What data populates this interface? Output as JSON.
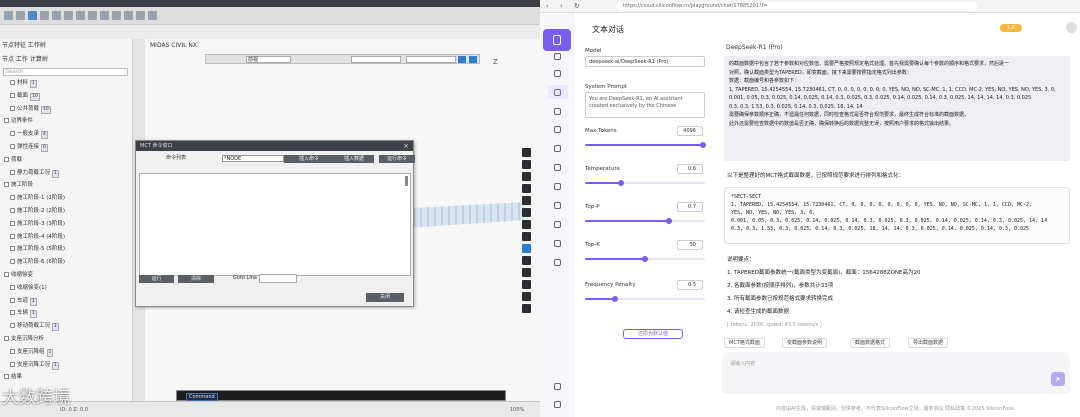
{
  "cad": {
    "panel_title": "节点特征  工作树",
    "panel_tabs": "节点  工作  计算树",
    "search_placeholder": "Search",
    "viewport_tab": "MIDAS CIVIL NX",
    "view_select": "前视",
    "axis_label": "Z",
    "tree": [
      {
        "label": "材料",
        "badge": "1"
      },
      {
        "label": "截面",
        "badge": "10"
      },
      {
        "label": "公共荷载",
        "badge": "10"
      },
      {
        "label": "边界条件",
        "badge": ""
      },
      {
        "label": "一般支承",
        "badge": "4"
      },
      {
        "label": "弹性连接",
        "badge": "6"
      },
      {
        "label": "荷载",
        "badge": ""
      },
      {
        "label": "静力荷载工况",
        "badge": "1"
      },
      {
        "label": "施工阶段",
        "badge": ""
      },
      {
        "label": "施工阶段-1 (1阶段)",
        "badge": ""
      },
      {
        "label": "施工阶段-2 (2阶段)",
        "badge": ""
      },
      {
        "label": "施工阶段-3 (3阶段)",
        "badge": ""
      },
      {
        "label": "施工阶段-4 (4阶段)",
        "badge": ""
      },
      {
        "label": "施工阶段-5 (5阶段)",
        "badge": ""
      },
      {
        "label": "施工阶段-6 (6阶段)",
        "badge": ""
      },
      {
        "label": "收缩徐变",
        "badge": ""
      },
      {
        "label": "收缩徐变(1)",
        "badge": ""
      },
      {
        "label": "车道",
        "badge": "1"
      },
      {
        "label": "车辆",
        "badge": "1"
      },
      {
        "label": "移动荷载工况",
        "badge": "1"
      },
      {
        "label": "支座沉降分析",
        "badge": ""
      },
      {
        "label": "支座沉降组",
        "badge": "1"
      },
      {
        "label": "支座沉降工况",
        "badge": "1"
      },
      {
        "label": "结果",
        "badge": ""
      }
    ],
    "dialog": {
      "title": "MCT 命令窗口",
      "label_cmd": "命令列表",
      "select_value": "*NODE",
      "btn_insert": "插入命令",
      "btn_insert_data": "插入数据",
      "btn_run": "运行命令",
      "btn_load": "运行",
      "btn_clear": "清除",
      "goto_label": "Goto Line",
      "close_btn": "关闭"
    },
    "command_label": "Command",
    "status_left": "ID: 0    Z: 0.0",
    "status_right": "100%",
    "watermark": "大数跨境"
  },
  "web": {
    "url": "https://cloud.siliconflow.cn/playground/chat/17885201?f=",
    "page_title": "文本对话",
    "coin": "1.0",
    "model_label": "Model",
    "model_value": "deepseek-ai/DeepSeek-R1 (Pro)",
    "system_prompt_label": "System Prompt",
    "system_prompt_value": "You are DeepSeek-R1, an AI assistant created exclusively by the Chinese",
    "params": [
      {
        "label": "Max Tokens",
        "value": "4096",
        "level": 0.98
      },
      {
        "label": "Temperature",
        "value": "0.6",
        "level": 0.3
      },
      {
        "label": "Top-P",
        "value": "0.7",
        "level": 0.7
      },
      {
        "label": "Top-K",
        "value": "50",
        "level": 0.5
      },
      {
        "label": "Frequency Penalty",
        "value": "0.5",
        "level": 0.25
      }
    ],
    "reset_btn": "还原为默认值",
    "model_name": "DeepSeek-R1 (Pro)",
    "msg_lines": [
      "的截面数据中包含了若干参数和对应数值，需要严格按照规定格式处理。首先我需要确认每个参数的顺序和格式要求，然后逐一",
      "对照，确认截面类型为TAPERED，即变截面。接下来需要按照指定格式列出参数：",
      "数据：截面编号和各参数如下：",
      "1, TAPERED, 15.4254554, 15.7230461, CT, 0, 0, 0, 0, 0, 0, 0, 0, YES, NO, NO, SC-MC, 1, 1, CCD, MC-2, YES, NO, YES, NO, YES, 3, 0,",
      "0.001, 0.05, 0.3, 0.025, 0.14, 0.025, 0.14, 0.3, 0.025, 0.3, 0.025, 0.14, 0.025, 0.14, 0.3, 0.025, 14, 14, 14, 14, 0.3, 0.025",
      "0.3, 0.3, 1.53, 0.3, 0.025, 0.14, 0.3, 0.025, 18, 14, 14",
      "需要确保参数顺序正确，不遗漏任何数据，同时检查格式是否符合规范要求，最终生成符合标准的截面数据。",
      "此外还需要检查数据中的数值是否正确，确保转换后的数据完整无误，按照用户要求的格式输出结果。"
    ],
    "msg2_title": "以下是整理好的MCT格式截面数据，已按照规范要求进行排列和格式化：",
    "code_lines": [
      "*SECT-SECT",
      "1, TAPERED, 15.4254554, 15.7230461, CT, 0, 0, 0, 0, 0, 0, 0, 0, YES, NO, NO, SC-MC, 1, 1, CCD, MC-2,",
      "YES, NO, YES, NO, YES, 3, 0,",
      "0.001, 0.05, 0.3, 0.025, 0.14, 0.025, 0.14, 0.3, 0.025, 0.3, 0.025, 0.14, 0.025, 0.14, 0.3, 0.025, 14, 14",
      "0.3, 0.3, 1.53, 0.3, 0.025, 0.14, 0.3, 0.025, 18, 14, 14, 0.3, 0.025, 0.14, 0.025, 0.14, 0.3, 0.025"
    ],
    "steps": [
      "说明要点：",
      "1. TAPERED截面参数统一(截面类型为变截面)，截面：1564288ZONE高为20",
      "2. 各截面参数(按顺序排列)，参数共计33项",
      "3. 所有截面参数已按规范格式要求转换完成",
      "4. 请检查生成的截面数据"
    ],
    "meta": "[ tokens: 2038, speed: 43.5 tokens/s ]",
    "chips": [
      "MCT格式截面",
      "变截面参数说明",
      "截面数据格式",
      "导出截面数据"
    ],
    "input_placeholder": "请输入内容",
    "send_icon": "➤",
    "footer": "内容由AI生成，请谨慎甄别。仅供参考，不代表SiliconFlow立场。服务协议 隐私政策 ©2025 SiliconFlow",
    "brand_color": "#7b5cf0"
  }
}
